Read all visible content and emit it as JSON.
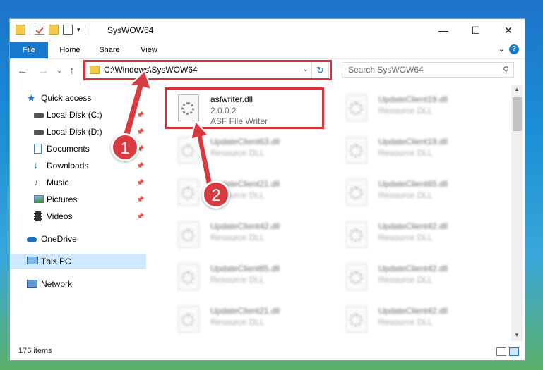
{
  "window": {
    "title": "SysWOW64",
    "controls": {
      "minimize": "—",
      "maximize": "☐",
      "close": "✕"
    }
  },
  "ribbon": {
    "tabs": [
      "File",
      "Home",
      "Share",
      "View"
    ],
    "expand": "⌄",
    "help": "?"
  },
  "navigation": {
    "back": "←",
    "forward": "→",
    "recent": "⌄",
    "up": "↑",
    "address": "C:\\Windows\\SysWOW64",
    "search_placeholder": "Search SysWOW64"
  },
  "sidebar": {
    "items": [
      {
        "label": "Quick access",
        "icon": "star-icon",
        "pinned": false
      },
      {
        "label": "Local Disk (C:)",
        "icon": "drive-icon",
        "pinned": true
      },
      {
        "label": "Local Disk (D:)",
        "icon": "drive-icon",
        "pinned": true
      },
      {
        "label": "Documents",
        "icon": "documents-icon",
        "pinned": true
      },
      {
        "label": "Downloads",
        "icon": "download-icon",
        "pinned": true
      },
      {
        "label": "Music",
        "icon": "music-icon",
        "pinned": true
      },
      {
        "label": "Pictures",
        "icon": "pictures-icon",
        "pinned": true
      },
      {
        "label": "Videos",
        "icon": "videos-icon",
        "pinned": true
      },
      {
        "label": "OneDrive",
        "icon": "cloud-icon",
        "pinned": false
      },
      {
        "label": "This PC",
        "icon": "computer-icon",
        "pinned": false,
        "selected": true
      },
      {
        "label": "Network",
        "icon": "network-icon",
        "pinned": false
      }
    ]
  },
  "files": {
    "featured": {
      "name": "asfwriter.dll",
      "version": "2.0.0.2",
      "description": "ASF File Writer"
    },
    "left_column": [
      {
        "name": "UpdateClient63.dll",
        "type": "Resource DLL"
      },
      {
        "name": "UpdateClient21.dll",
        "type": "Resource DLL"
      },
      {
        "name": "UpdateClient42.dll",
        "type": "Resource DLL"
      },
      {
        "name": "UpdateClient65.dll",
        "type": "Resource DLL"
      },
      {
        "name": "UpdateClient21.dll",
        "type": "Resource DLL"
      }
    ],
    "right_column": [
      {
        "name": "UpdateClient19.dll",
        "type": "Resource DLL"
      },
      {
        "name": "UpdateClient19.dll",
        "type": "Resource DLL"
      },
      {
        "name": "UpdateClient65.dll",
        "type": "Resource DLL"
      },
      {
        "name": "UpdateClient42.dll",
        "type": "Resource DLL"
      },
      {
        "name": "UpdateClient42.dll",
        "type": "Resource DLL"
      },
      {
        "name": "UpdateClient42.dll",
        "type": "Resource DLL"
      }
    ]
  },
  "status": {
    "item_count": "176 items"
  },
  "annotations": {
    "marker_1": "1",
    "marker_2": "2"
  },
  "colors": {
    "accent": "#1979ca",
    "highlight": "#d9303a",
    "selected": "#cde8ff"
  }
}
